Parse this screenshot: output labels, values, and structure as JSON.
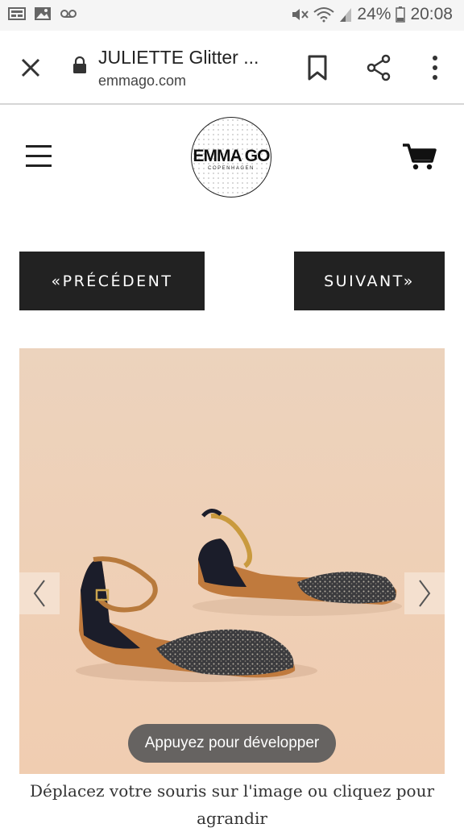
{
  "status_bar": {
    "battery": "24%",
    "time": "20:08",
    "icons": [
      "news-icon",
      "image-icon",
      "voicemail-icon",
      "mute-icon",
      "wifi-icon",
      "signal-icon",
      "battery-icon"
    ]
  },
  "browser": {
    "page_title": "JULIETTE Glitter ...",
    "domain": "emmago.com",
    "icons": [
      "close-icon",
      "lock-icon",
      "bookmark-icon",
      "share-icon",
      "more-icon"
    ]
  },
  "header": {
    "logo_main": "EMMA GO",
    "logo_sub": "COPENHAGEN",
    "icons": [
      "hamburger-icon",
      "cart-icon"
    ]
  },
  "nav": {
    "prev_label": "«PRÉCÉDENT",
    "next_label": "SUIVANT»"
  },
  "gallery": {
    "expand_label": "Appuyez pour développer",
    "caption": "Déplacez votre souris sur l'image ou cliquez pour agrandir"
  },
  "colors": {
    "dark_button": "#222222",
    "image_background": "#efd2bb"
  }
}
